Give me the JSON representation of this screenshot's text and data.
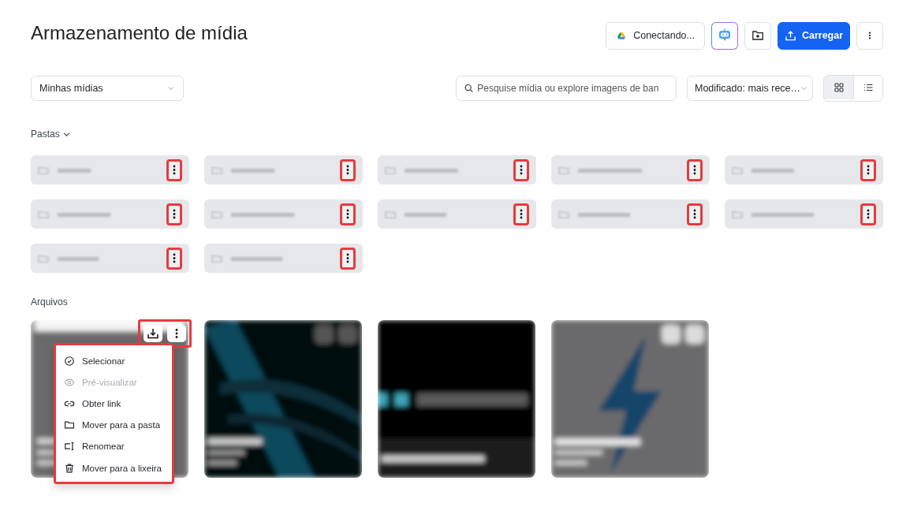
{
  "title": "Armazenamento de mídia",
  "header_actions": {
    "drive_button": "Conectando...",
    "upload_button": "Carregar"
  },
  "toolbar": {
    "scope_dropdown": "Minhas mídias",
    "search": {
      "placeholder": "Pesquise mídia ou explore imagens de ban"
    },
    "sort_dropdown": "Modificado: mais rece…",
    "views": [
      {
        "kind": "grid",
        "selected": true
      },
      {
        "kind": "list",
        "selected": false
      }
    ]
  },
  "folders_section": {
    "label": "Pastas",
    "expanded": true
  },
  "folders": [
    {
      "menu_highlighted": true
    },
    {
      "menu_highlighted": true
    },
    {
      "menu_highlighted": true
    },
    {
      "menu_highlighted": true
    },
    {
      "menu_highlighted": true
    },
    {
      "menu_highlighted": true
    },
    {
      "menu_highlighted": true
    },
    {
      "menu_highlighted": true
    },
    {
      "menu_highlighted": true
    },
    {
      "menu_highlighted": true
    },
    {
      "menu_highlighted": true
    },
    {
      "menu_highlighted": true
    }
  ],
  "files_section": {
    "label": "Arquivos"
  },
  "files": [
    {
      "kind": "blank",
      "menu_open": true
    },
    {
      "kind": "streaks",
      "menu_open": false
    },
    {
      "kind": "wordmark",
      "menu_open": false
    },
    {
      "kind": "bolt",
      "menu_open": false
    }
  ],
  "context_menu": [
    {
      "kind": "check",
      "label": "Selecionar",
      "disabled": false
    },
    {
      "kind": "eye",
      "label": "Pré-visualizar",
      "disabled": true
    },
    {
      "kind": "link",
      "label": "Obter link",
      "disabled": false
    },
    {
      "kind": "folder",
      "label": "Mover para a pasta",
      "disabled": false
    },
    {
      "kind": "rename",
      "label": "Renomear",
      "disabled": false
    },
    {
      "kind": "trash",
      "label": "Mover para a lixeira",
      "disabled": false
    }
  ]
}
